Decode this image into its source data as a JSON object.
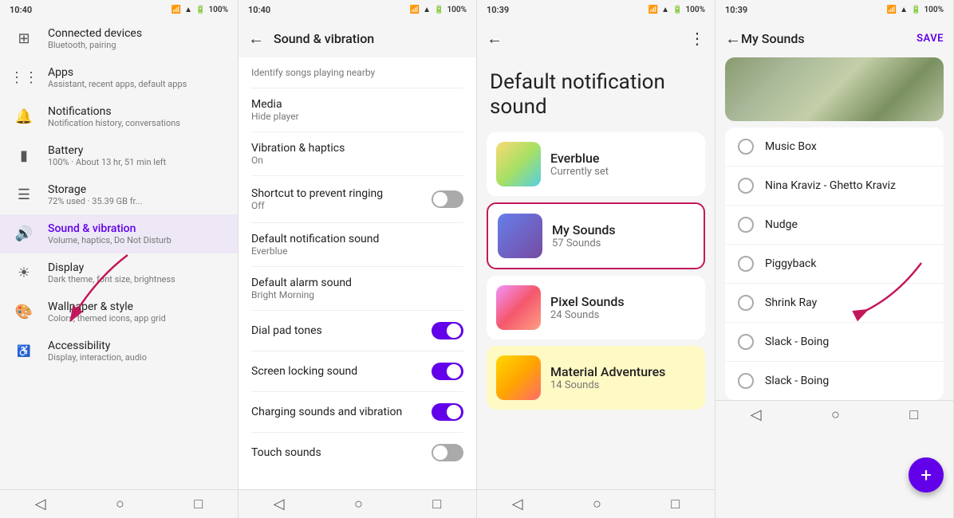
{
  "panel1": {
    "status_time": "10:40",
    "status_icons": "📶🔋 100%",
    "items": [
      {
        "id": "connected",
        "icon": "⊞",
        "title": "Connected devices",
        "subtitle": "Bluetooth, pairing"
      },
      {
        "id": "apps",
        "icon": "⋮⋮",
        "title": "Apps",
        "subtitle": "Assistant, recent apps, default apps"
      },
      {
        "id": "notifications",
        "icon": "🔔",
        "title": "Notifications",
        "subtitle": "Notification history, conversations"
      },
      {
        "id": "battery",
        "icon": "🔋",
        "title": "Battery",
        "subtitle": "100% · About 13 hr, 51 min left"
      },
      {
        "id": "storage",
        "icon": "☰",
        "title": "Storage",
        "subtitle": "72% used · 35.39 GB fr..."
      },
      {
        "id": "sound",
        "icon": "🔊",
        "title": "Sound & vibration",
        "subtitle": "Volume, haptics, Do Not Disturb",
        "active": true
      },
      {
        "id": "display",
        "icon": "⚙",
        "title": "Display",
        "subtitle": "Dark theme, font size, brightness"
      },
      {
        "id": "wallpaper",
        "icon": "🎨",
        "title": "Wallpaper & style",
        "subtitle": "Colors, themed icons, app grid"
      },
      {
        "id": "accessibility",
        "icon": "♿",
        "title": "Accessibility",
        "subtitle": "Display, interaction, audio"
      }
    ],
    "bottom_nav": [
      "◀",
      "●",
      "■"
    ]
  },
  "panel2": {
    "status_time": "10:40",
    "header_title": "Sound & vibration",
    "identify_songs": "Identify songs playing nearby",
    "media_label": "Media",
    "media_sub": "Hide player",
    "vibration_label": "Vibration & haptics",
    "vibration_sub": "On",
    "shortcut_label": "Shortcut to prevent ringing",
    "shortcut_sub": "Off",
    "shortcut_toggle": "off",
    "default_notif_label": "Default notification sound",
    "default_notif_sub": "Everblue",
    "default_alarm_label": "Default alarm sound",
    "default_alarm_sub": "Bright Morning",
    "dialpad_label": "Dial pad tones",
    "dialpad_toggle": "on",
    "screen_lock_label": "Screen locking sound",
    "screen_lock_toggle": "on",
    "charging_label": "Charging sounds and vibration",
    "charging_toggle": "on",
    "touch_label": "Touch sounds",
    "touch_toggle": "off",
    "bottom_nav": [
      "◀",
      "●",
      "■"
    ]
  },
  "panel3": {
    "status_time": "10:39",
    "page_title": "Default notification\nsound",
    "cards": [
      {
        "id": "everblue",
        "name": "Everblue",
        "sub": "Currently set",
        "selected": false,
        "thumb": "everblue"
      },
      {
        "id": "mysounds",
        "name": "My Sounds",
        "sub": "57 Sounds",
        "selected": true,
        "thumb": "mysounds"
      },
      {
        "id": "pixel",
        "name": "Pixel Sounds",
        "sub": "24 Sounds",
        "selected": false,
        "thumb": "pixel"
      },
      {
        "id": "material",
        "name": "Material Adventures",
        "sub": "14 Sounds",
        "selected": false,
        "thumb": "material"
      }
    ],
    "bottom_nav": [
      "◀",
      "●",
      "■"
    ]
  },
  "panel4": {
    "status_time": "10:39",
    "header_title": "My Sounds",
    "save_label": "SAVE",
    "sounds": [
      {
        "id": "musicbox",
        "name": "Music Box",
        "selected": false
      },
      {
        "id": "ninakraviz",
        "name": "Nina Kraviz - Ghetto Kraviz",
        "selected": false
      },
      {
        "id": "nudge",
        "name": "Nudge",
        "selected": false
      },
      {
        "id": "piggyback",
        "name": "Piggyback",
        "selected": false
      },
      {
        "id": "shrinkray",
        "name": "Shrink Ray",
        "selected": false
      },
      {
        "id": "slackboing1",
        "name": "Slack - Boing",
        "selected": false
      },
      {
        "id": "slackboing2",
        "name": "Slack - Boing",
        "selected": false
      }
    ],
    "fab_label": "+",
    "bottom_nav": [
      "◀",
      "●",
      "■"
    ]
  }
}
